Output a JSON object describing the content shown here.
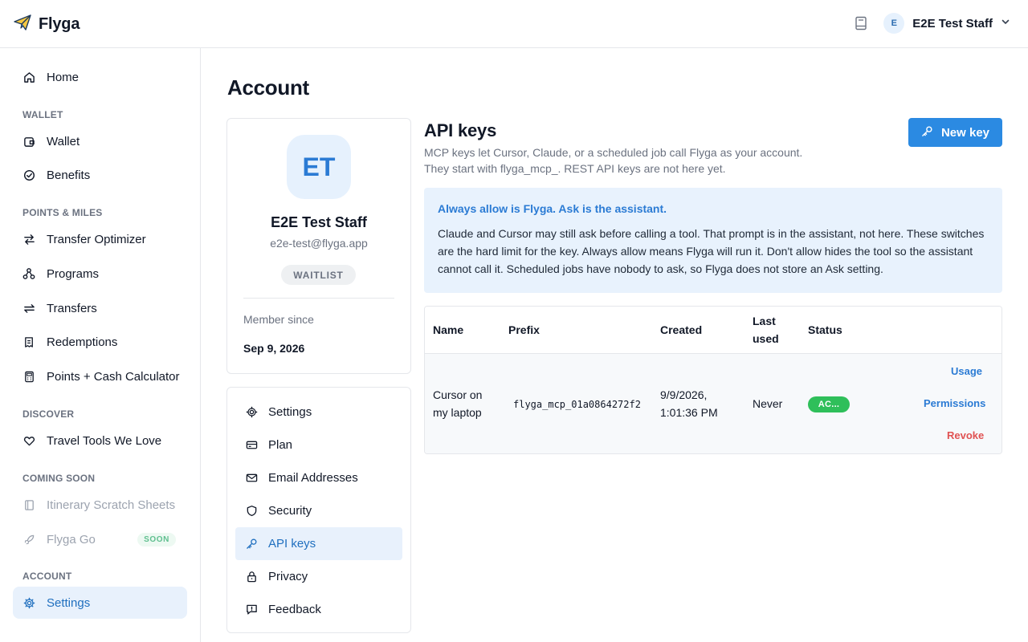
{
  "app": {
    "name": "Flyga"
  },
  "header": {
    "user_initial": "E",
    "user_name": "E2E Test Staff"
  },
  "sidebar": {
    "home": "Home",
    "sections": {
      "wallet": "WALLET",
      "points": "POINTS & MILES",
      "discover": "DISCOVER",
      "coming_soon": "COMING SOON",
      "account": "ACCOUNT"
    },
    "items": {
      "wallet": "Wallet",
      "benefits": "Benefits",
      "transfer_optimizer": "Transfer Optimizer",
      "programs": "Programs",
      "transfers": "Transfers",
      "redemptions": "Redemptions",
      "points_cash": "Points + Cash Calculator",
      "travel_tools": "Travel Tools We Love",
      "itinerary": "Itinerary Scratch Sheets",
      "flyga_go": "Flyga Go",
      "settings": "Settings"
    },
    "soon_badge": "SOON"
  },
  "page": {
    "title": "Account"
  },
  "profile": {
    "initials": "ET",
    "name": "E2E Test Staff",
    "email": "e2e-test@flyga.app",
    "badge": "WAITLIST",
    "member_since_label": "Member since",
    "member_since_value": "Sep 9, 2026"
  },
  "settings_nav": {
    "settings": "Settings",
    "plan": "Plan",
    "email": "Email Addresses",
    "security": "Security",
    "api_keys": "API keys",
    "privacy": "Privacy",
    "feedback": "Feedback"
  },
  "api": {
    "title": "API keys",
    "desc_line1": "MCP keys let Cursor, Claude, or a scheduled job call Flyga as your account.",
    "desc_line2": "They start with flyga_mcp_. REST API keys are not here yet.",
    "new_key_label": "New key",
    "info_title": "Always allow is Flyga. Ask is the assistant.",
    "info_body": "Claude and Cursor may still ask before calling a tool. That prompt is in the assistant, not here. These switches are the hard limit for the key. Always allow means Flyga will run it. Don't allow hides the tool so the assistant cannot call it. Scheduled jobs have nobody to ask, so Flyga does not store an Ask setting."
  },
  "table": {
    "headers": {
      "name": "Name",
      "prefix": "Prefix",
      "created": "Created",
      "last_used_1": "Last",
      "last_used_2": "used",
      "status": "Status"
    },
    "rows": [
      {
        "name_1": "Cursor on",
        "name_2": "my laptop",
        "prefix": "flyga_mcp_01a0864272f2",
        "created_1": "9/9/2026,",
        "created_2": "1:01:36 PM",
        "last_used": "Never",
        "status": "AC...",
        "actions": {
          "usage": "Usage",
          "permissions": "Permissions",
          "revoke": "Revoke"
        }
      }
    ]
  },
  "colors": {
    "accent": "#2b8ae2",
    "active_bg": "#e8f1fc",
    "status_green": "#2fbf5a",
    "danger": "#e05252"
  }
}
